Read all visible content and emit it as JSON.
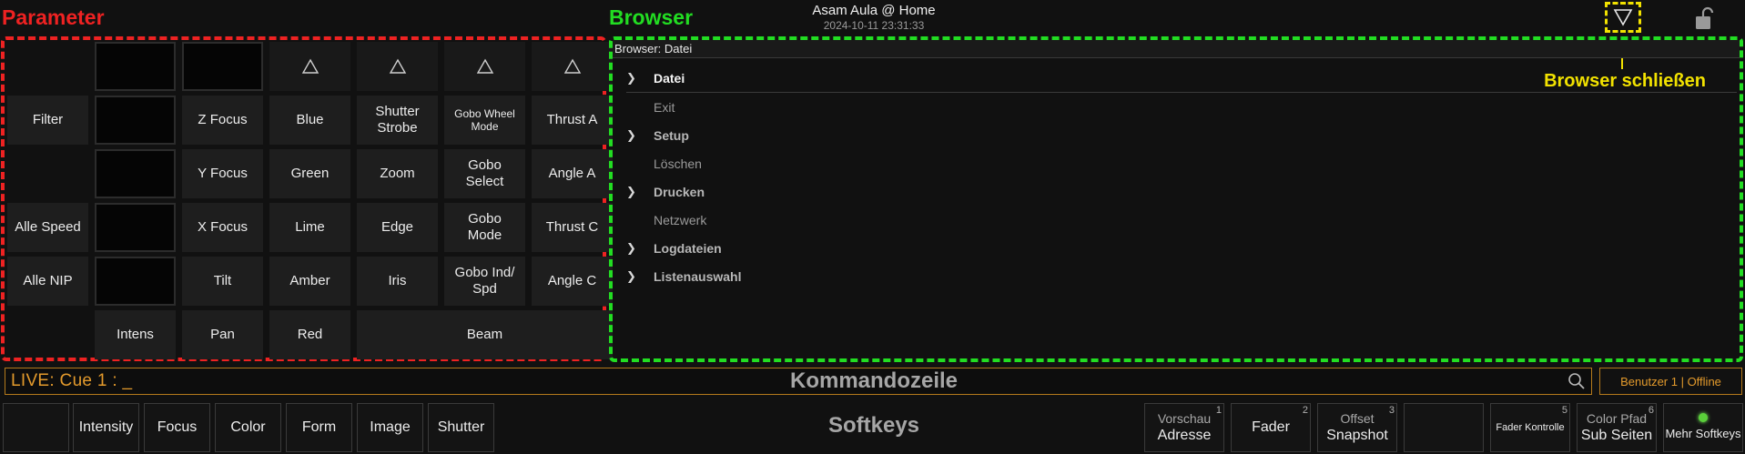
{
  "headings": {
    "parameter": "Parameter",
    "browser": "Browser"
  },
  "session": {
    "name": "Asam Aula @ Home",
    "datetime": "2024-10-11 23:31:33"
  },
  "browser_close": {
    "label": "Browser schließen"
  },
  "parameter_grid": [
    [
      {
        "type": "empty"
      },
      {
        "type": "blank"
      },
      {
        "type": "blank"
      },
      {
        "type": "arrow",
        "icon": "triangle-up-icon"
      },
      {
        "type": "arrow",
        "icon": "triangle-up-icon"
      },
      {
        "type": "arrow",
        "icon": "triangle-up-icon"
      },
      {
        "type": "arrow",
        "icon": "triangle-up-icon"
      }
    ],
    [
      {
        "label": "Filter"
      },
      {
        "type": "blank"
      },
      {
        "label": "Z Focus"
      },
      {
        "label": "Blue"
      },
      {
        "label": "Shutter\nStrobe"
      },
      {
        "label": "Gobo Wheel\nMode",
        "small": true
      },
      {
        "label": "Thrust A"
      }
    ],
    [
      {
        "type": "empty"
      },
      {
        "type": "blank"
      },
      {
        "label": "Y Focus"
      },
      {
        "label": "Green"
      },
      {
        "label": "Zoom"
      },
      {
        "label": "Gobo\nSelect"
      },
      {
        "label": "Angle A"
      }
    ],
    [
      {
        "label": "Alle Speed"
      },
      {
        "type": "blank"
      },
      {
        "label": "X Focus"
      },
      {
        "label": "Lime"
      },
      {
        "label": "Edge"
      },
      {
        "label": "Gobo\nMode"
      },
      {
        "label": "Thrust C"
      }
    ],
    [
      {
        "label": "Alle NIP"
      },
      {
        "type": "blank"
      },
      {
        "label": "Tilt"
      },
      {
        "label": "Amber"
      },
      {
        "label": "Iris"
      },
      {
        "label": "Gobo Ind/\nSpd"
      },
      {
        "label": "Angle C"
      }
    ],
    [
      {
        "type": "empty"
      },
      {
        "label": "Intens"
      },
      {
        "label": "Pan"
      },
      {
        "label": "Red"
      },
      {
        "label": "Beam",
        "span": 3
      }
    ]
  ],
  "browser": {
    "header": "Browser: Datei",
    "items": [
      {
        "label": "Datei",
        "folder": true,
        "selected": true
      },
      {
        "label": "Exit",
        "folder": false
      },
      {
        "label": "Setup",
        "folder": true
      },
      {
        "label": "Löschen",
        "folder": false
      },
      {
        "label": "Drucken",
        "folder": true
      },
      {
        "label": "Netzwerk",
        "folder": false
      },
      {
        "label": "Logdateien",
        "folder": true
      },
      {
        "label": "Listenauswahl",
        "folder": true
      }
    ]
  },
  "command_line": {
    "live_text": "LIVE: Cue  1 :  _",
    "title": "Kommandozeile",
    "user_status": "Benutzer 1 | Offline"
  },
  "softkeys": {
    "title": "Softkeys",
    "left": [
      "",
      "Intensity",
      "Focus",
      "Color",
      "Form",
      "Image",
      "Shutter"
    ],
    "right": [
      {
        "top": "Vorschau",
        "label": "Adresse",
        "num": "1"
      },
      {
        "top": "",
        "label": "Fader",
        "num": "2"
      },
      {
        "top": "Offset",
        "label": "Snapshot",
        "num": "3"
      },
      {
        "top": "",
        "label": "",
        "num": ""
      },
      {
        "top": "",
        "label": "Fader Kontrolle",
        "num": "5",
        "small": true
      },
      {
        "top": "Color Pfad",
        "label": "Sub Seiten",
        "num": "6"
      },
      {
        "top": "",
        "label": "Mehr Softkeys",
        "num": "",
        "led": true
      }
    ]
  },
  "colors": {
    "parameter_outline": "#ee2222",
    "browser_outline": "#22dd22",
    "annotation": "#f2e200",
    "command_accent": "#e39a2c"
  }
}
